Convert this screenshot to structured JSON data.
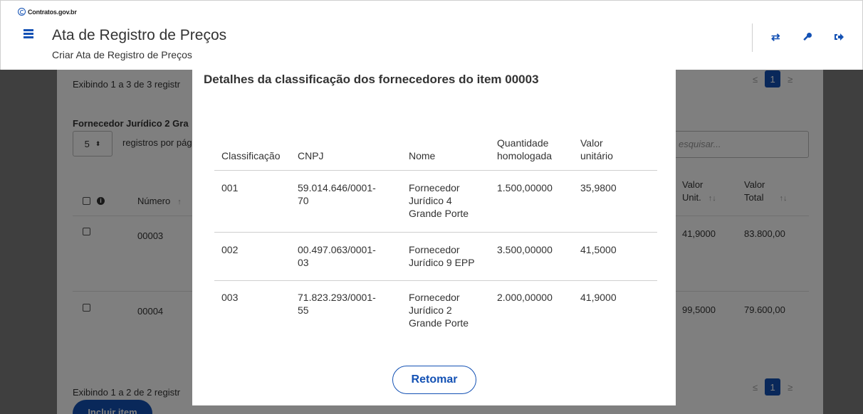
{
  "header": {
    "brand": "Contratos.gov.br",
    "title": "Ata de Registro de Preços",
    "subtitle": "Criar Ata de Registro de Preços",
    "icons": [
      "exchange-icon",
      "key-icon",
      "logout-icon"
    ]
  },
  "background": {
    "showing_top": "Exibindo 1 a 3 de 3 registr",
    "pager_top_page": "1",
    "supplier_heading": "Fornecedor Jurídico 2 Gra",
    "per_page_value": "5",
    "per_page_label": "registros por pág",
    "search_placeholder": "esquisar...",
    "col_numero": "Número",
    "col_valor_unit_1": "Valor",
    "col_valor_unit_2": "Unit.",
    "col_valor_total_1": "Valor",
    "col_valor_total_2": "Total",
    "rows": [
      {
        "numero": "00003",
        "valor_unit": "41,9000",
        "valor_total": "83.800,00"
      },
      {
        "numero": "00004",
        "valor_unit": "99,5000",
        "valor_total": "79.600,00"
      }
    ],
    "showing_bottom": "Exibindo 1 a 2 de 2 registr",
    "pager_bottom_page": "1",
    "include_button": "Incluir item"
  },
  "modal": {
    "title": "Detalhes da classificação dos fornecedores do item 00003",
    "columns": {
      "classificacao": "Classificação",
      "cnpj": "CNPJ",
      "nome": "Nome",
      "quantidade_1": "Quantidade",
      "quantidade_2": "homologada",
      "valor_1": "Valor",
      "valor_2": "unitário"
    },
    "rows": [
      {
        "classificacao": "001",
        "cnpj_1": "59.014.646/0001-",
        "cnpj_2": "70",
        "nome_1": "Fornecedor",
        "nome_2": "Jurídico 4",
        "nome_3": "Grande Porte",
        "quantidade": "1.500,00000",
        "valor": "35,9800"
      },
      {
        "classificacao": "002",
        "cnpj_1": "00.497.063/0001-",
        "cnpj_2": "03",
        "nome_1": "Fornecedor",
        "nome_2": "Jurídico 9 EPP",
        "nome_3": "",
        "quantidade": "3.500,00000",
        "valor": "41,5000"
      },
      {
        "classificacao": "003",
        "cnpj_1": "71.823.293/0001-",
        "cnpj_2": "55",
        "nome_1": "Fornecedor",
        "nome_2": "Jurídico 2",
        "nome_3": "Grande Porte",
        "quantidade": "2.000,00000",
        "valor": "41,9000"
      }
    ],
    "close_button": "Retomar"
  }
}
